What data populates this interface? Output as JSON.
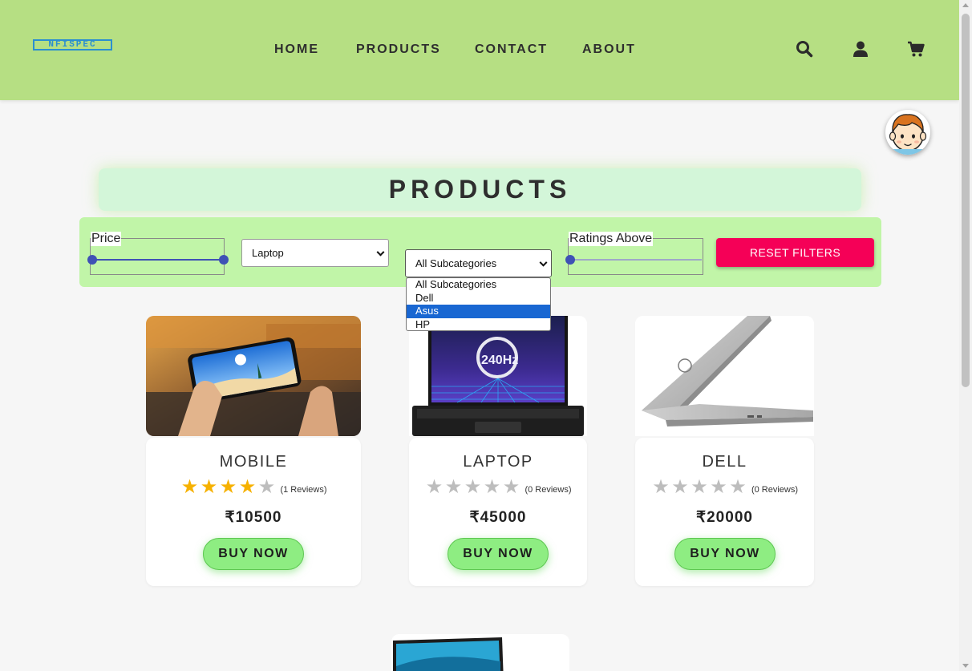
{
  "nav": {
    "logo_text": "NFISPEC",
    "links": [
      "HOME",
      "PRODUCTS",
      "CONTACT",
      "ABOUT"
    ],
    "icons": [
      "search-icon",
      "user-icon",
      "cart-icon"
    ],
    "bg_color": "#b6df83"
  },
  "page_title": "PRODUCTS",
  "filters": {
    "price_label": "Price",
    "category_selected": "Laptop",
    "subcategory_selected": "All Subcategories",
    "subcategory_options": [
      "All Subcategories",
      "Dell",
      "Asus",
      "HP"
    ],
    "subcategory_highlighted": "Asus",
    "ratings_label": "Ratings Above",
    "ratings_value": 0,
    "reset_label": "RESET FILTERS",
    "reset_color": "#f50057"
  },
  "products": [
    {
      "name": "MOBILE",
      "rating": 4,
      "reviews": "(1 Reviews)",
      "price": "₹10500",
      "buy_label": "BUY NOW"
    },
    {
      "name": "LAPTOP",
      "rating": 0,
      "reviews": "(0 Reviews)",
      "price": "₹45000",
      "buy_label": "BUY NOW"
    },
    {
      "name": "DELL",
      "rating": 0,
      "reviews": "(0 Reviews)",
      "price": "₹20000",
      "buy_label": "BUY NOW"
    }
  ],
  "colors": {
    "star_on": "#f6b100",
    "star_off": "#bdbdbd",
    "buy_button": "#8eed82",
    "accent": "#3f51b5"
  }
}
